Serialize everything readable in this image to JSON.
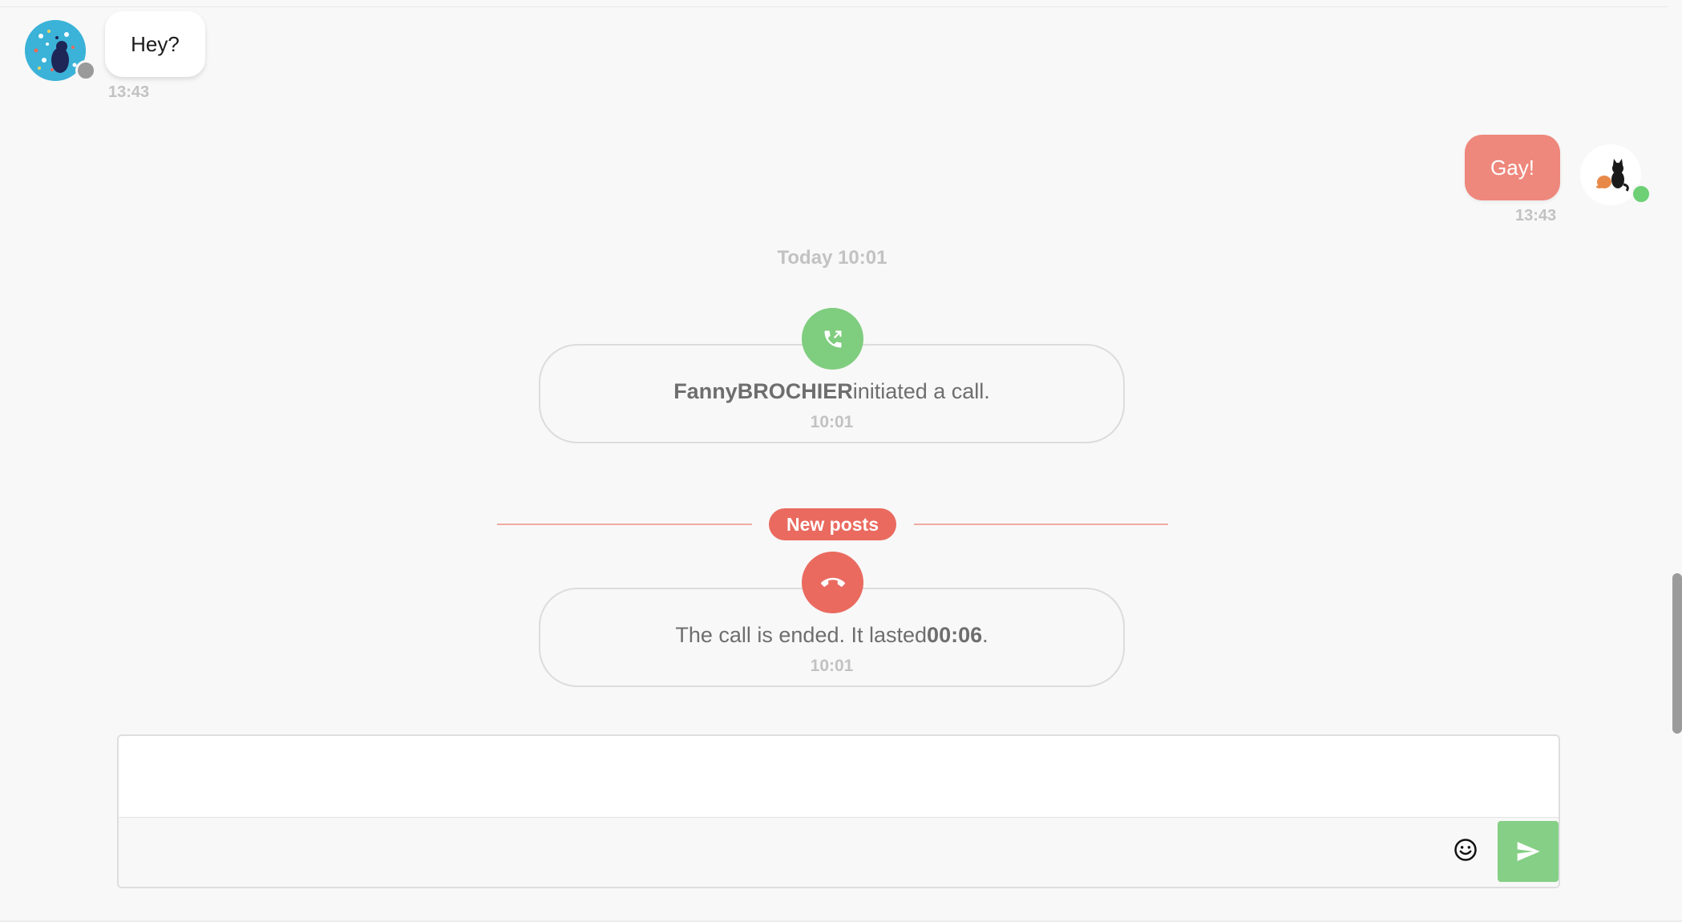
{
  "conversation": {
    "incoming_message": {
      "text": "Hey?",
      "time": "13:43",
      "sender_status": "offline"
    },
    "outgoing_message": {
      "text": "Gay!",
      "time": "13:43",
      "sender_status": "online"
    },
    "date_separator": "Today 10:01",
    "call_started": {
      "caller": "FannyBROCHIER",
      "text": "initiated a call.",
      "time": "10:01",
      "icon": "phone-outgoing-icon"
    },
    "new_posts_label": "New posts",
    "call_ended": {
      "text_before": "The call is ended. It lasted",
      "duration": "00:06",
      "text_after": ".",
      "time": "10:01",
      "icon": "phone-hangup-icon"
    }
  },
  "composer": {
    "input_value": "",
    "emoji_icon": "emoji-smile-icon",
    "send_icon": "send-arrow-icon"
  },
  "colors": {
    "outgoing_bubble": "#ee877c",
    "accent_red": "#ea6a5f",
    "call_green": "#7fcd7f",
    "send_green": "#86cf86",
    "online": "#6dd075",
    "offline": "#9a9a9a"
  }
}
